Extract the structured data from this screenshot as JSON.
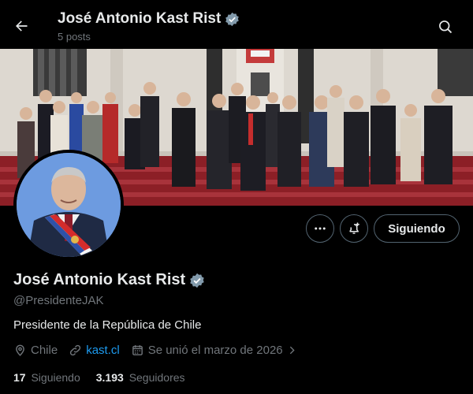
{
  "header": {
    "title": "José Antonio Kast Rist",
    "subtitle": "5 posts"
  },
  "profile": {
    "name": "José Antonio Kast Rist",
    "handle": "@PresidenteJAK",
    "bio": "Presidente de la República de Chile",
    "location": "Chile",
    "website": "kast.cl",
    "joined": "Se unió el marzo de 2026",
    "following_count": "17",
    "following_label": "Siguiendo",
    "followers_count": "3.193",
    "followers_label": "Seguidores",
    "verified": true
  },
  "actions": {
    "follow_label": "Siguiendo"
  },
  "icons": {
    "back": "arrow-left-icon",
    "search": "search-icon",
    "verified": "verified-badge-icon",
    "more": "more-icon",
    "notify": "bell-plus-icon",
    "location": "location-icon",
    "link": "link-icon",
    "calendar": "calendar-icon",
    "chevron": "chevron-right-icon"
  },
  "colors": {
    "background": "#000000",
    "text": "#e7e9ea",
    "muted": "#71767b",
    "link": "#1d9bf0",
    "border": "#536471",
    "verified": "#829aab"
  }
}
